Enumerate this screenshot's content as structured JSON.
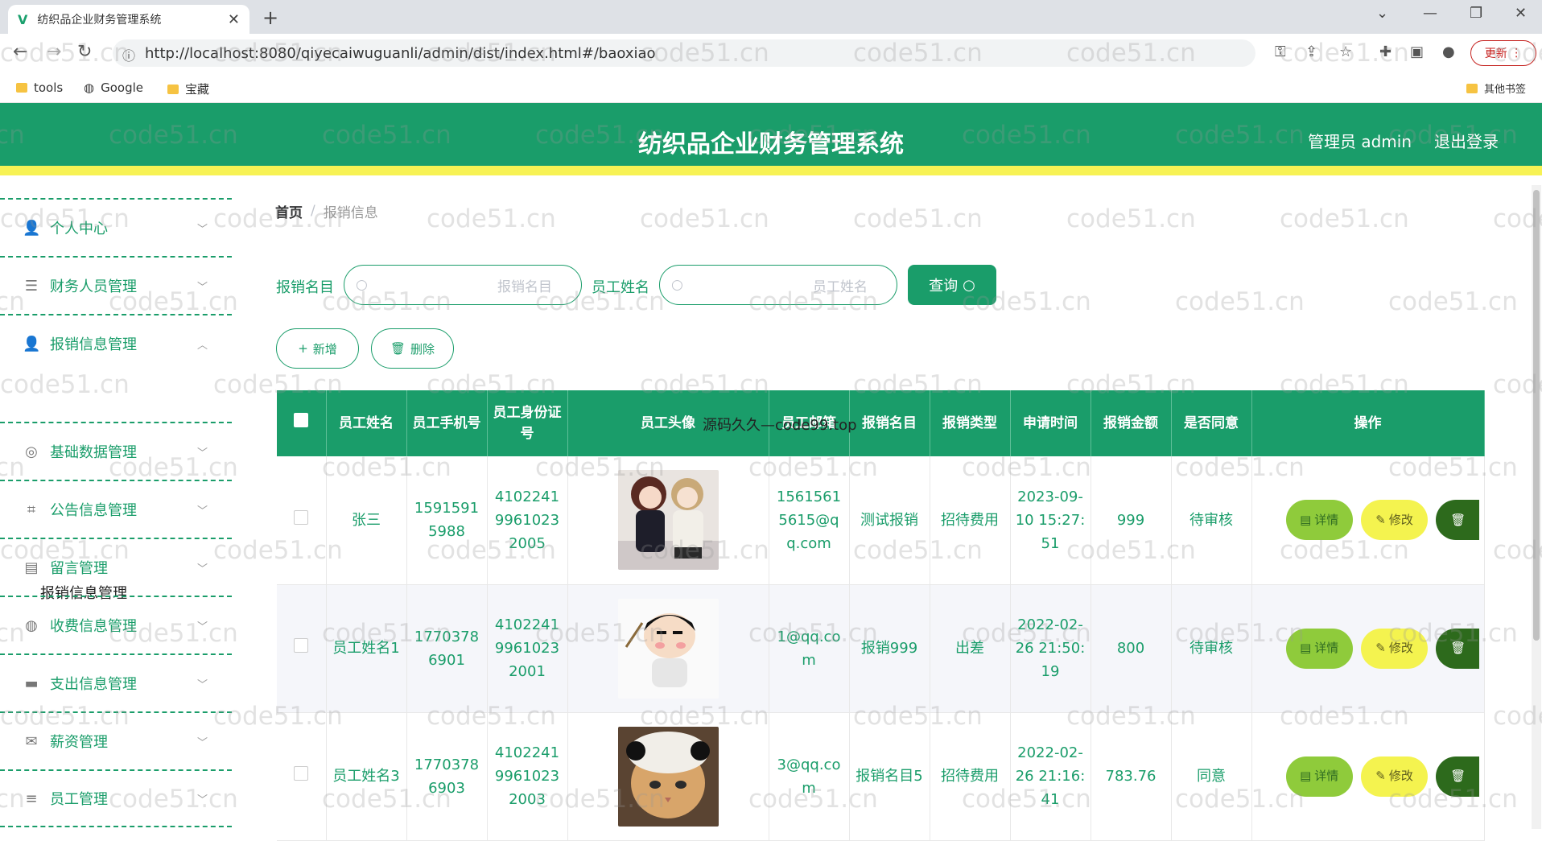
{
  "browser": {
    "tab_title": "纺织品企业财务管理系统",
    "url": "http://localhost:8080/qiyecaiwuguanli/admin/dist/index.html#/baoxiao",
    "update_label": "更新",
    "bookmarks": [
      "tools",
      "Google",
      "宝藏"
    ],
    "other_bookmarks": "其他书签"
  },
  "header": {
    "title": "纺织品企业财务管理系统",
    "user": "管理员 admin",
    "logout": "退出登录"
  },
  "sidebar": {
    "items": [
      {
        "label": "个人中心",
        "icon": "user-icon"
      },
      {
        "label": "财务人员管理",
        "icon": "sliders-icon"
      },
      {
        "label": "报销信息管理",
        "icon": "user-icon"
      },
      {
        "label": "基础数据管理",
        "icon": "target-icon"
      },
      {
        "label": "公告信息管理",
        "icon": "crop-icon"
      },
      {
        "label": "留言管理",
        "icon": "briefcase-icon"
      },
      {
        "label": "收费信息管理",
        "icon": "globe-icon"
      },
      {
        "label": "支出信息管理",
        "icon": "chat-icon"
      },
      {
        "label": "薪资管理",
        "icon": "mail-icon"
      },
      {
        "label": "员工管理",
        "icon": "list-icon"
      }
    ],
    "submenu": "报销信息管理"
  },
  "breadcrumb": {
    "home": "首页",
    "separator": "/",
    "current": "报销信息"
  },
  "search": {
    "name_label": "报销名目",
    "name_placeholder": "报销名目",
    "emp_label": "员工姓名",
    "emp_placeholder": "员工姓名",
    "query": "查询"
  },
  "actions": {
    "add": "新增",
    "delete": "删除"
  },
  "table": {
    "headers": [
      "员工姓名",
      "员工手机号",
      "员工身份证号",
      "员工头像",
      "员工邮箱",
      "报销名目",
      "报销类型",
      "申请时间",
      "报销金额",
      "是否同意",
      "操作"
    ],
    "rows": [
      {
        "name": "张三",
        "phone": "15915915988",
        "idcard": "410224199610232005",
        "email": "15615615615@qq.com",
        "item": "测试报销",
        "type": "招待费用",
        "time": "2023-09-10 15:27:51",
        "amount": "999",
        "agree": "待审核"
      },
      {
        "name": "员工姓名1",
        "phone": "17703786901",
        "idcard": "410224199610232001",
        "email": "1@qq.com",
        "item": "报销999",
        "type": "出差",
        "time": "2022-02-26 21:50:19",
        "amount": "800",
        "agree": "待审核"
      },
      {
        "name": "员工姓名3",
        "phone": "17703786903",
        "idcard": "410224199610232003",
        "email": "3@qq.com",
        "item": "报销名目5",
        "type": "招待费用",
        "time": "2022-02-26 21:16:41",
        "amount": "783.76",
        "agree": "同意"
      }
    ],
    "btn_detail": "详情",
    "btn_edit": "修改",
    "btn_delete": "删除"
  },
  "overlay_text": "源码久久—code99.top",
  "watermark": "code51.cn",
  "colors": {
    "primary": "#1a9d6a",
    "accent_bar": "#f7f254",
    "detail": "#8fcb3b",
    "edit": "#f4f34f",
    "delete": "#2d6a1c"
  }
}
